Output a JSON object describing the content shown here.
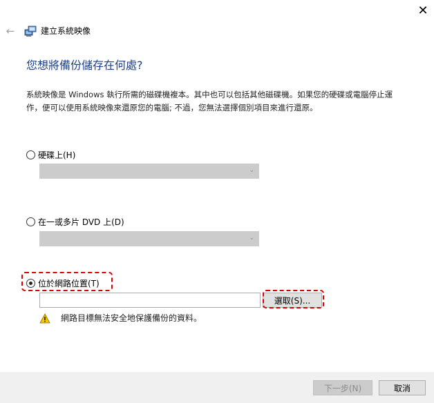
{
  "window": {
    "close_glyph": "✕",
    "back_glyph": "←",
    "title": "建立系統映像"
  },
  "main": {
    "heading": "您想將備份儲存在何處?",
    "description": "系統映像是 Windows 執行所需的磁碟機複本。其中也可以包括其他磁碟機。如果您的硬碟或電腦停止運作，便可以使用系統映像來還原您的電腦; 不過，您無法選擇個別項目來進行還原。"
  },
  "options": {
    "hard_disk": {
      "label": "硬碟上(H)",
      "selected": false
    },
    "dvd": {
      "label": "在一或多片 DVD 上(D)",
      "selected": false
    },
    "network": {
      "label": "位於網路位置(T)",
      "selected": true,
      "path_value": "",
      "select_label": "選取(S)..."
    }
  },
  "warning": {
    "icon": "warning-icon",
    "text": "網路目標無法安全地保護備份的資料。"
  },
  "footer": {
    "next_label": "下一步(N)",
    "next_enabled": false,
    "cancel_label": "取消"
  },
  "colors": {
    "heading": "#1e3f8a",
    "highlight": "#d80000",
    "footer_bg": "#f0f0f0",
    "disabled_combo": "#cccccc"
  }
}
